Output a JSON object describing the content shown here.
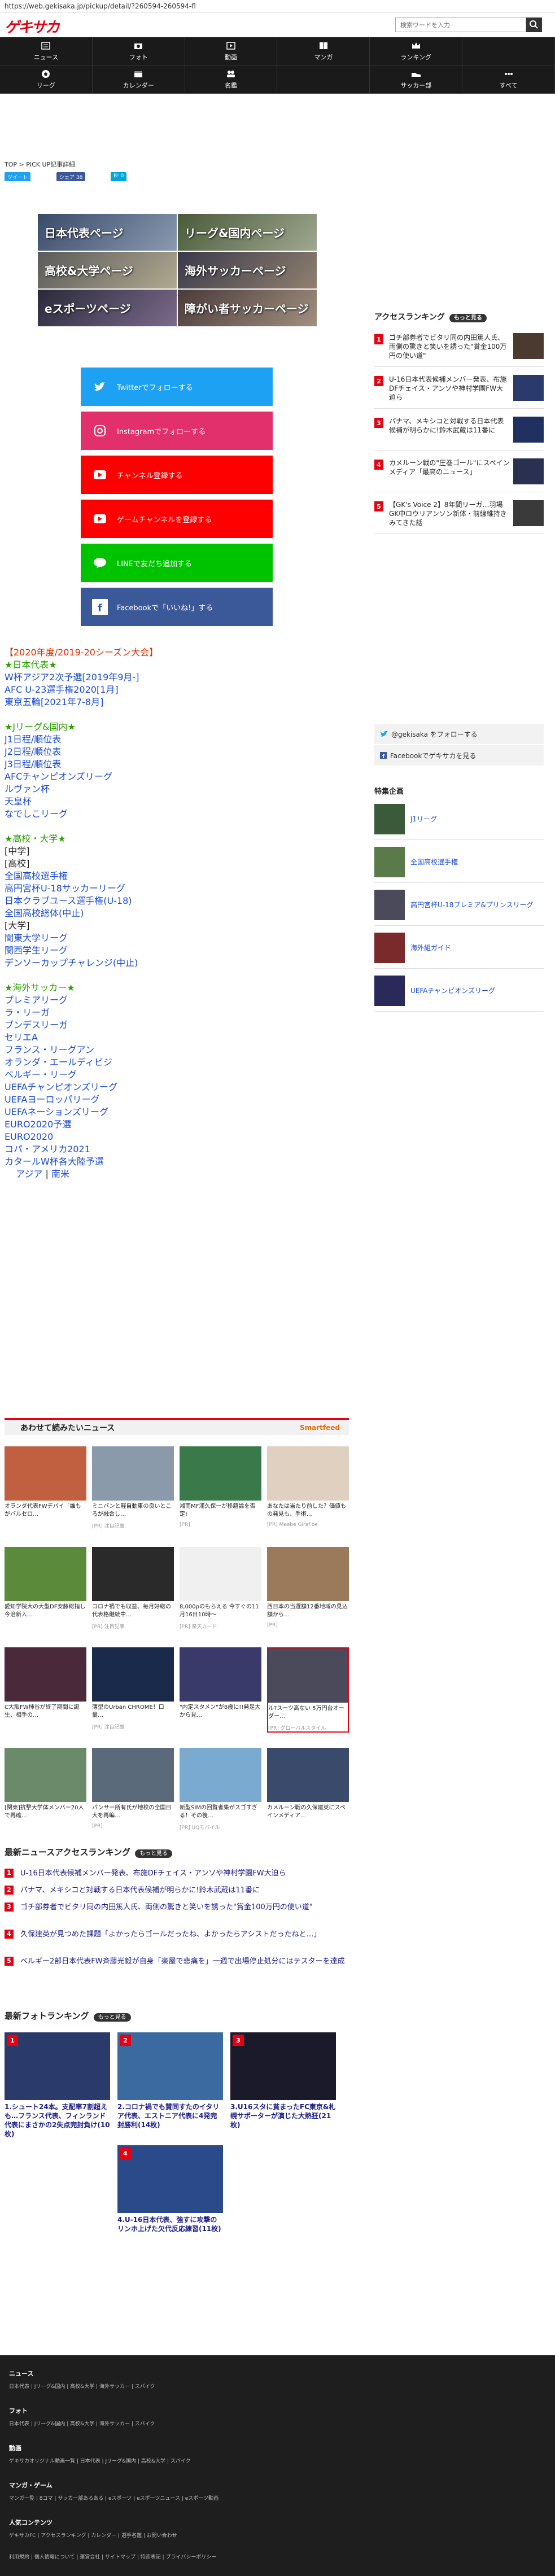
{
  "url": "https://web.gekisaka.jp/pickup/detail/?260594-260594-fl",
  "logo": "ゲキサカ",
  "search": {
    "placeholder": "検索ワードを入力"
  },
  "nav": [
    {
      "label": "ニュース",
      "icon": "news-icon"
    },
    {
      "label": "フォト",
      "icon": "camera-icon"
    },
    {
      "label": "動画",
      "icon": "video-icon"
    },
    {
      "label": "マンガ",
      "icon": "manga-icon"
    },
    {
      "label": "ランキング",
      "icon": "crown-icon"
    },
    {
      "label": "",
      "icon": ""
    },
    {
      "label": "リーグ",
      "icon": "ball-icon"
    },
    {
      "label": "カレンダー",
      "icon": "calendar-icon"
    },
    {
      "label": "名鑑",
      "icon": "people-icon"
    },
    {
      "label": "",
      "icon": ""
    },
    {
      "label": "サッカー部",
      "icon": "shoe-icon"
    },
    {
      "label": "すべて",
      "icon": "more-icon"
    }
  ],
  "breadcrumb": "TOP > PICK UP記事詳細",
  "share": {
    "tweet": "ツイート",
    "fb": "シェア 38",
    "hatena": "B! 0"
  },
  "banners": [
    "日本代表ページ",
    "リーグ&国内ページ",
    "高校&大学ページ",
    "海外サッカーページ",
    "eスポーツページ",
    "障がい者サッカーページ"
  ],
  "sns": [
    {
      "label": "Twitterでフォローする",
      "color": "#1da1f2"
    },
    {
      "label": "Instagramでフォローする",
      "color": "#e1306c"
    },
    {
      "label": "チャンネル登録する",
      "color": "#ff0000"
    },
    {
      "label": "ゲームチャンネルを登録する",
      "color": "#ff0000"
    },
    {
      "label": "LINEで友だち追加する",
      "color": "#00c300"
    },
    {
      "label": "Facebookで「いいね!」する",
      "color": "#3b5998"
    }
  ],
  "links": {
    "head": "【2020年度/2019-20シーズン大会】",
    "japan_title": "★日本代表★",
    "japan": [
      "W杯アジア2次予選[2019年9月-]",
      "AFC U-23選手権2020[1月]",
      "東京五輪[2021年7-8月]"
    ],
    "jleague_title": "★Jリーグ&国内★",
    "jleague": [
      "J1日程/順位表",
      "J2日程/順位表",
      "J3日程/順位表",
      "AFCチャンピオンズリーグ",
      "ルヴァン杯",
      "天皇杯",
      "なでしこリーグ"
    ],
    "school_title": "★高校・大学★",
    "school_cat1": "[中学]",
    "school_cat2": "[高校]",
    "school": [
      "全国高校選手権",
      "高円宮杯U-18サッカーリーグ",
      "日本クラブユース選手権(U-18)",
      "全国高校総体(中止)"
    ],
    "school_cat3": "[大学]",
    "univ": [
      "関東大学リーグ",
      "関西学生リーグ",
      "デンソーカップチャレンジ(中止)"
    ],
    "overseas_title": "★海外サッカー★",
    "overseas": [
      "プレミアリーグ",
      "ラ・リーガ",
      "ブンデスリーガ",
      "セリエA",
      "フランス・リーグアン",
      "オランダ・エールディビジ",
      "ベルギー・リーグ",
      "UEFAチャンピオンズリーグ",
      "UEFAヨーロッパリーグ",
      "UEFAネーションズリーグ",
      "EURO2020予選",
      "EURO2020",
      "コパ・アメリカ2021",
      "カタールW杯各大陸予選"
    ],
    "region_a": "アジア",
    "region_b": "南米"
  },
  "side_ranking": {
    "title": "アクセスランキング",
    "more": "もっと見る",
    "items": [
      "ゴチ部券者でビタリ同の内田篤人氏、両側の驚きと笑いを誘った\"賞金100万円の使い道\"",
      "U-16日本代表候補メンバー発表、布施DFチェイス・アンソや神村学園FW大迫ら",
      "パナマ、メキシコと対戦する日本代表候補が明らかに!鈴木武蔵は11番に",
      "カメルーン戦の\"圧巻ゴール\"にスペインメディア「最高のニュース」",
      "【GK's Voice 2】8年間リーガ…羽場GK中ロウリアンソン新体・前線維持きみてきた話"
    ]
  },
  "side_sns": {
    "twitter": "@gekisaka をフォローする",
    "facebook": "Facebookでゲキサカを見る"
  },
  "special": {
    "title": "特集企画",
    "items": [
      "J1リーグ",
      "全国高校選手権",
      "高円宮杯U-18プレミア&プリンスリーグ",
      "海外組ガイド",
      "UEFAチャンピオンズリーグ"
    ]
  },
  "smartfeed": {
    "title": "あわせて読みたいニュース",
    "brand": "Smartfeed"
  },
  "cards": [
    {
      "cap": "オランダ代表FWデパイ「誰もがバルセロ…",
      "src": ""
    },
    {
      "cap": "ミニバンと軽自動車の良いところが融合し…",
      "src": "[PR] 注目記事"
    },
    {
      "cap": "湘南MF浦久保一が移籍論を否定!",
      "src": "[PR]"
    },
    {
      "cap": "あなたは当たり前した？価値もの発見も、手術…",
      "src": "[PR] Meebe Giraf.be"
    },
    {
      "cap": "愛知学院大の大型DF安藤総指し今治新入…",
      "src": ""
    },
    {
      "cap": "コロナ禍でも収益、毎月好総の代表格継続中…",
      "src": "[PR] 注目記事"
    },
    {
      "cap": "8,000pのもらえる 今すぐの11月16日10時～",
      "src": "[PR] 楽天カード"
    },
    {
      "cap": "西日本の当選額12番地域の見込額から…",
      "src": "[PR]"
    },
    {
      "cap": "C大阪FW柿谷が終了期間に誕生、相手の…",
      "src": ""
    },
    {
      "cap": "薄型のUrban CHROME！口量…",
      "src": "[PR] 注目記事"
    },
    {
      "cap": "\"内定スタメン\"が8歳に!!発足大から見…",
      "src": ""
    },
    {
      "cap": "ル?スーツ高ない 5万円台オーダー…",
      "src": "[PR] グローバルスタイル"
    },
    {
      "cap": "[関東]抗撃大学体メンバー20人で再確…",
      "src": ""
    },
    {
      "cap": "パンサー所有氏が地校の全国日大を再編…",
      "src": "[PR]"
    },
    {
      "cap": "新型SIMの回覧者集がスゴすぎる！その後…",
      "src": "[PR] UQモバイル"
    },
    {
      "cap": "カメルーン戦の久保建英にスペインメディア…",
      "src": ""
    }
  ],
  "news_ranking": {
    "title": "最新ニュースアクセスランキング",
    "more": "もっと見る",
    "items": [
      "U-16日本代表候補メンバー発表、布施DFチェイス・アンソや神村学園FW大迫ら",
      "パナマ、メキシコと対戦する日本代表候補が明らかに!鈴木武蔵は11番に",
      "ゴチ部券者でビタリ同の内田篤人氏、両側の驚きと笑いを誘った\"賞金100万円の使い道\"",
      "久保建英が見つめた課題「よかったらゴールだったね、よかったらアシストだったねと…」",
      "ベルギー2部日本代表FW斉藤光毅が自身「楽屋で悲痛を」一週で出場停止処分にはテスターを達成"
    ]
  },
  "photo_ranking": {
    "title": "最新フォトランキング",
    "more": "もっと見る",
    "items": [
      "1.シュート24本。支配率7割超えも…フランス代表、フィンランド代表にまさかの2失点完封負け(10枚)",
      "2.コロナ禍でも賛同すたのイタリア代表、エストニア代表に4発完封勝利(14枚)",
      "3.U16スタに貧まったFC東京&札幌サポーターが演じた大熱狂(21枚)",
      "4.U-16日本代表、強すに攻撃のリンホ上げた欠代反応練習(11枚)"
    ]
  },
  "footer": [
    {
      "title": "ニュース",
      "links": "日本代表 | Jリーグ&国内 | 高校&大学 | 海外サッカー | スパイク"
    },
    {
      "title": "フォト",
      "links": "日本代表 | Jリーグ&国内 | 高校&大学 | 海外サッカー | スパイク"
    },
    {
      "title": "動画",
      "links": "ゲキサカオリジナル動画一覧 | 日本代表 | Jリーグ&国内 | 高校&大学 | スパイク"
    },
    {
      "title": "マンガ・ゲーム",
      "links": "マンガ一覧 | 8コマ | サッカー部あるある | eスポーツ | eスポーツニュース | eスポーツ動画"
    },
    {
      "title": "人気コンテンツ",
      "links": "ゲキサカFC | アクセスランキング | カレンダー | 選手名鑑 | お問い合わせ"
    }
  ],
  "footer_bottom": "利用規約 | 個人情報について | 運営会社 | サイトマップ | 特商表記 | プライバシーポリシー"
}
